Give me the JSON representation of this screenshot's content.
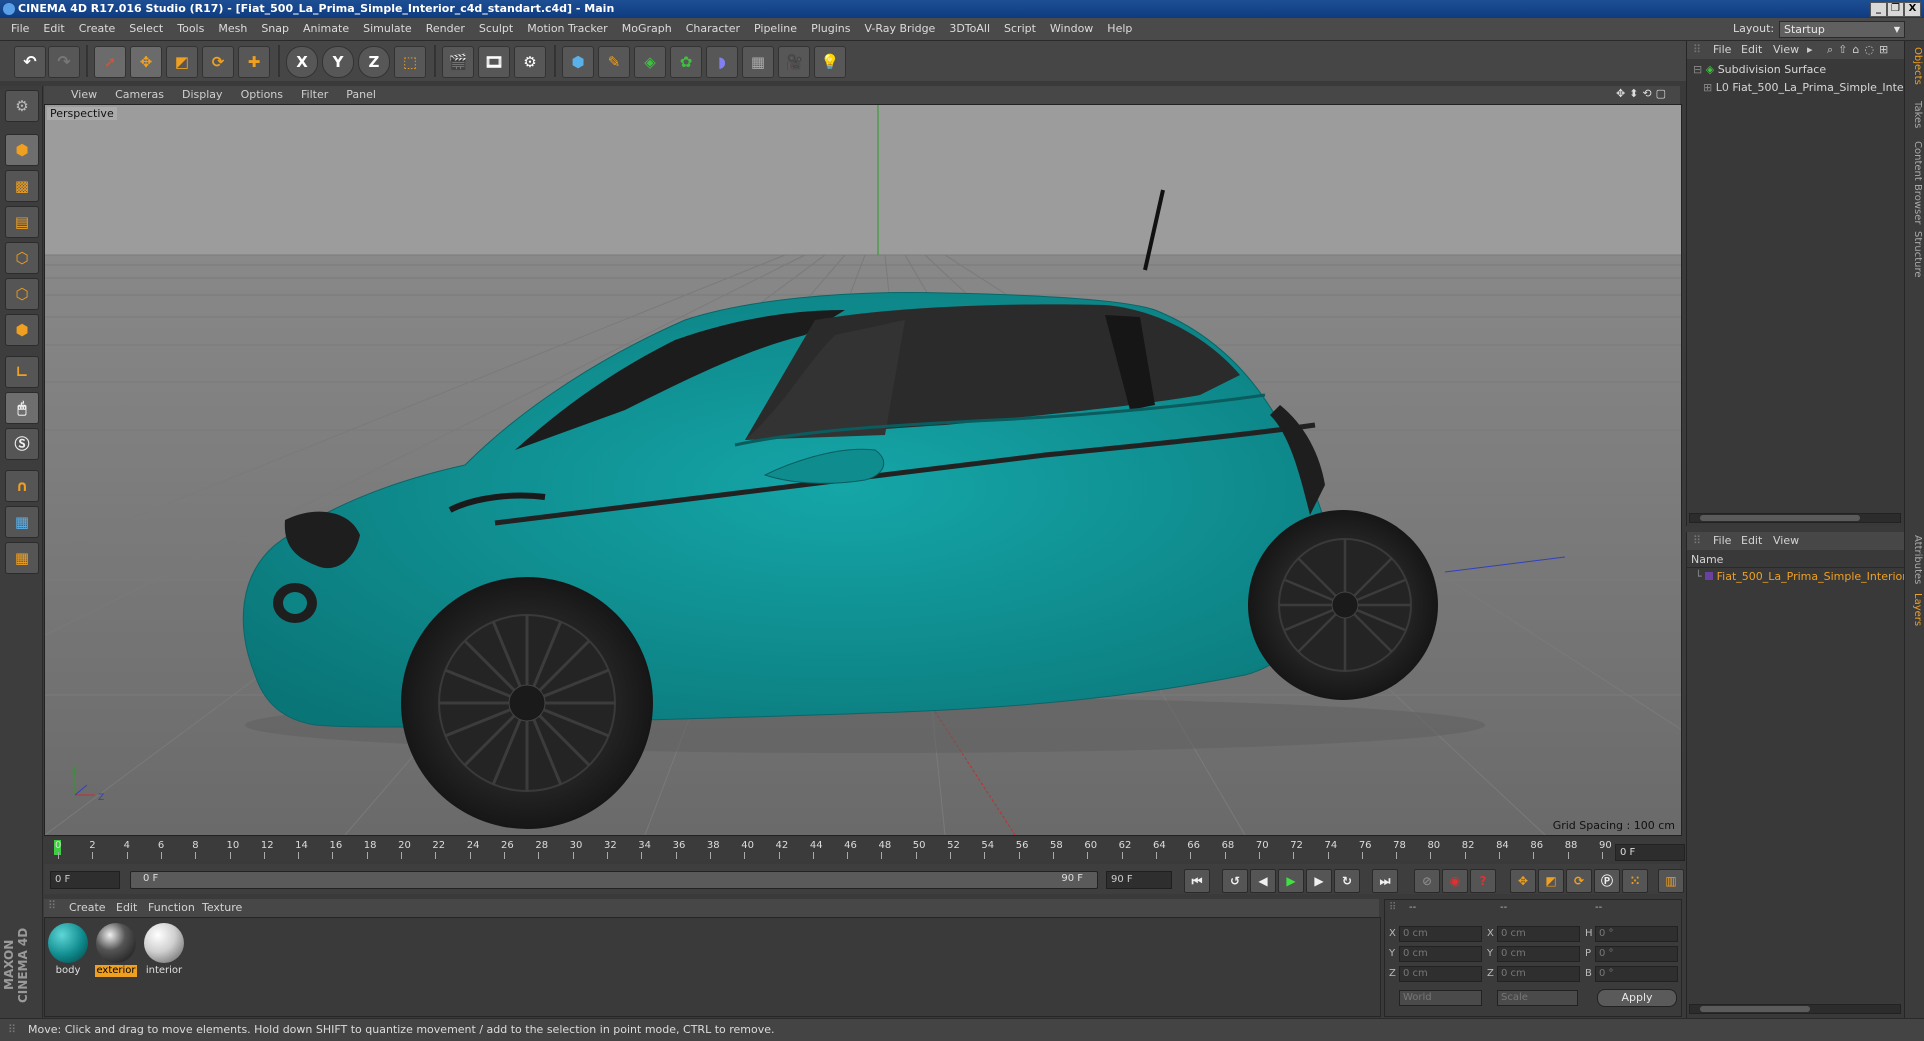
{
  "window": {
    "title": "CINEMA 4D R17.016 Studio (R17) - [Fiat_500_La_Prima_Simple_Interior_c4d_standart.c4d] - Main",
    "min": "_",
    "restore": "❐",
    "close": "X"
  },
  "menu": {
    "items": [
      "File",
      "Edit",
      "Create",
      "Select",
      "Tools",
      "Mesh",
      "Snap",
      "Animate",
      "Simulate",
      "Render",
      "Sculpt",
      "Motion Tracker",
      "MoGraph",
      "Character",
      "Pipeline",
      "Plugins",
      "V-Ray Bridge",
      "3DToAll",
      "Script",
      "Window",
      "Help"
    ],
    "layout_label": "Layout:",
    "layout_value": "Startup"
  },
  "toolbar": {
    "axis_x": "X",
    "axis_y": "Y",
    "axis_z": "Z"
  },
  "viewport": {
    "menu": [
      "View",
      "Cameras",
      "Display",
      "Options",
      "Filter",
      "Panel"
    ],
    "camera_label": "Perspective",
    "grid_spacing": "Grid Spacing : 100 cm",
    "axis_y": "Y",
    "axis_z": "Z"
  },
  "timeline": {
    "ticks": [
      "0",
      "2",
      "4",
      "6",
      "8",
      "10",
      "12",
      "14",
      "16",
      "18",
      "20",
      "22",
      "24",
      "26",
      "28",
      "30",
      "32",
      "34",
      "36",
      "38",
      "40",
      "42",
      "44",
      "46",
      "48",
      "50",
      "52",
      "54",
      "56",
      "58",
      "60",
      "62",
      "64",
      "66",
      "68",
      "70",
      "72",
      "74",
      "76",
      "78",
      "80",
      "82",
      "84",
      "86",
      "88",
      "90"
    ],
    "current_frame": "0 F",
    "start_field": "0 F",
    "range_start": "0 F",
    "range_end": "90 F",
    "end_field": "90 F"
  },
  "materials": {
    "menu": [
      "Create",
      "Edit",
      "Function",
      "Texture"
    ],
    "items": [
      {
        "name": "body",
        "color": "#0f8a8c",
        "selected": false
      },
      {
        "name": "exterior",
        "color": "#3a3a3a",
        "selected": true
      },
      {
        "name": "interior",
        "color": "#d8d8d8",
        "selected": false
      }
    ]
  },
  "coords": {
    "header1": "--",
    "header2": "--",
    "header3": "--",
    "rows": [
      {
        "l1": "X",
        "v1": "0 cm",
        "l2": "X",
        "v2": "0 cm",
        "l3": "H",
        "v3": "0 °"
      },
      {
        "l1": "Y",
        "v1": "0 cm",
        "l2": "Y",
        "v2": "0 cm",
        "l3": "P",
        "v3": "0 °"
      },
      {
        "l1": "Z",
        "v1": "0 cm",
        "l2": "Z",
        "v2": "0 cm",
        "l3": "B",
        "v3": "0 °"
      }
    ],
    "space": "World",
    "mode": "Scale",
    "apply": "Apply"
  },
  "objects_panel": {
    "menu": [
      "File",
      "Edit",
      "View"
    ],
    "items": [
      "Subdivision Surface",
      "Fiat_500_La_Prima_Simple_Interior"
    ]
  },
  "layers_panel": {
    "menu": [
      "File",
      "Edit",
      "View"
    ],
    "column": "Name",
    "items": [
      "Fiat_500_La_Prima_Simple_Interior"
    ]
  },
  "side_tabs": [
    "Objects",
    "Takes",
    "Content Browser",
    "Structure",
    "Attributes",
    "Layers"
  ],
  "status": "Move: Click and drag to move elements. Hold down SHIFT to quantize movement / add to the selection in point mode, CTRL to remove.",
  "brand": "MAXON CINEMA 4D",
  "colors": {
    "car": "#129a9c",
    "accent": "#f0a020",
    "selection": "#f0a020"
  }
}
